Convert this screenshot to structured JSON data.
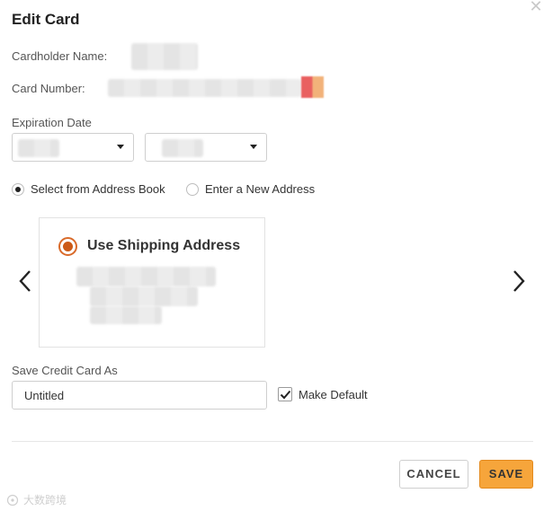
{
  "dialog": {
    "title": "Edit Card",
    "close_icon": "close-icon"
  },
  "card": {
    "cardholder_label": "Cardholder Name:",
    "card_number_label": "Card Number:",
    "expiration_label": "Expiration Date"
  },
  "address": {
    "option_address_book": "Select from Address Book",
    "option_new_address": "Enter a New Address",
    "selected_option": "Select from Address Book",
    "card_title": "Use Shipping Address",
    "prev_icon": "chevron-left-icon",
    "next_icon": "chevron-right-icon"
  },
  "save_as": {
    "label": "Save Credit Card As",
    "value": "Untitled",
    "make_default_label": "Make Default",
    "make_default_checked": true
  },
  "actions": {
    "cancel_label": "CANCEL",
    "save_label": "SAVE"
  },
  "colors": {
    "accent_orange": "#f6a53b",
    "radio_selected": "#cc5a17"
  },
  "watermark": {
    "text": "大数跨境"
  }
}
